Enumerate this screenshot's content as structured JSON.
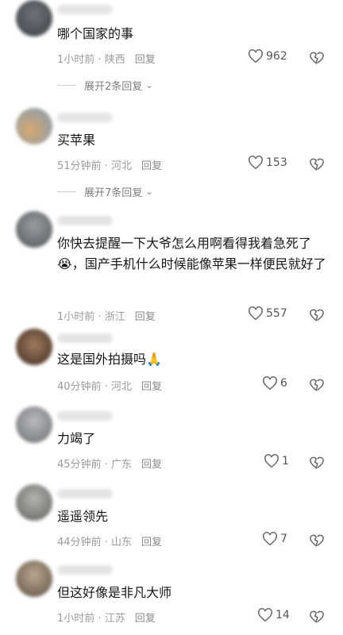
{
  "comments": [
    {
      "text": "哪个国家的事",
      "time": "1小时前",
      "location": "陕西",
      "reply": "回复",
      "likes": "962",
      "expand": "展开2条回复",
      "avatar_color": "#4a4f55"
    },
    {
      "text": "买苹果",
      "time": "51分钟前",
      "location": "河北",
      "reply": "回复",
      "likes": "153",
      "expand": "展开7条回复",
      "avatar_color": "#c79a62"
    },
    {
      "text": "你快去提醒一下大爷怎么用啊看得我着急死了😭，国产手机什么时候能像苹果一样便民就好了",
      "time": "1小时前",
      "location": "浙江",
      "reply": "回复",
      "likes": "557",
      "avatar_color": "#707478"
    },
    {
      "text": "这是国外拍摄吗🙏",
      "time": "40分钟前",
      "location": "河北",
      "reply": "回复",
      "likes": "6",
      "avatar_color": "#6b4a3c"
    },
    {
      "text": "力竭了",
      "time": "45分钟前",
      "location": "广东",
      "reply": "回复",
      "likes": "1",
      "avatar_color": "#8d8f92"
    },
    {
      "text": "遥遥领先",
      "time": "44分钟前",
      "location": "山东",
      "reply": "回复",
      "likes": "7",
      "avatar_color": "#8a8c86"
    },
    {
      "text": "但这好像是非凡大师",
      "time": "1小时前",
      "location": "江苏",
      "reply": "回复",
      "likes": "14",
      "avatar_color": "#8a7a68"
    }
  ],
  "meta_separator": " · "
}
